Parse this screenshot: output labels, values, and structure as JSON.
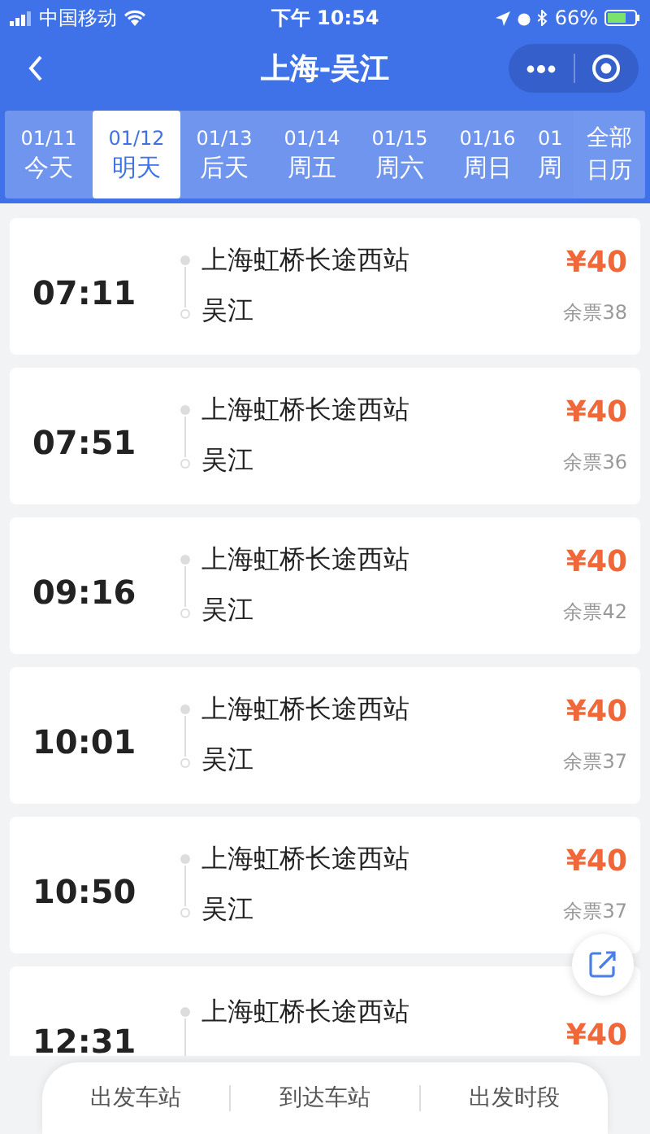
{
  "status_bar": {
    "carrier": "中国移动",
    "time": "下午 10:54",
    "battery": "66%"
  },
  "header": {
    "title": "上海-吴江"
  },
  "dates": [
    {
      "date": "01/11",
      "day": "今天",
      "selected": false
    },
    {
      "date": "01/12",
      "day": "明天",
      "selected": true
    },
    {
      "date": "01/13",
      "day": "后天",
      "selected": false
    },
    {
      "date": "01/14",
      "day": "周五",
      "selected": false
    },
    {
      "date": "01/15",
      "day": "周六",
      "selected": false
    },
    {
      "date": "01/16",
      "day": "周日",
      "selected": false
    },
    {
      "date": "01",
      "day": "周",
      "selected": false
    }
  ],
  "calendar_button": {
    "line1": "全部",
    "line2": "日历"
  },
  "trips": [
    {
      "time": "07:11",
      "from": "上海虹桥长途西站",
      "to": "吴江",
      "price": "¥40",
      "remaining": "余票38"
    },
    {
      "time": "07:51",
      "from": "上海虹桥长途西站",
      "to": "吴江",
      "price": "¥40",
      "remaining": "余票36"
    },
    {
      "time": "09:16",
      "from": "上海虹桥长途西站",
      "to": "吴江",
      "price": "¥40",
      "remaining": "余票42"
    },
    {
      "time": "10:01",
      "from": "上海虹桥长途西站",
      "to": "吴江",
      "price": "¥40",
      "remaining": "余票37"
    },
    {
      "time": "10:50",
      "from": "上海虹桥长途西站",
      "to": "吴江",
      "price": "¥40",
      "remaining": "余票37"
    },
    {
      "time": "12:31",
      "from": "上海虹桥长途西站",
      "price": "¥40"
    }
  ],
  "filters": [
    "出发车站",
    "到达车站",
    "出发时段"
  ]
}
